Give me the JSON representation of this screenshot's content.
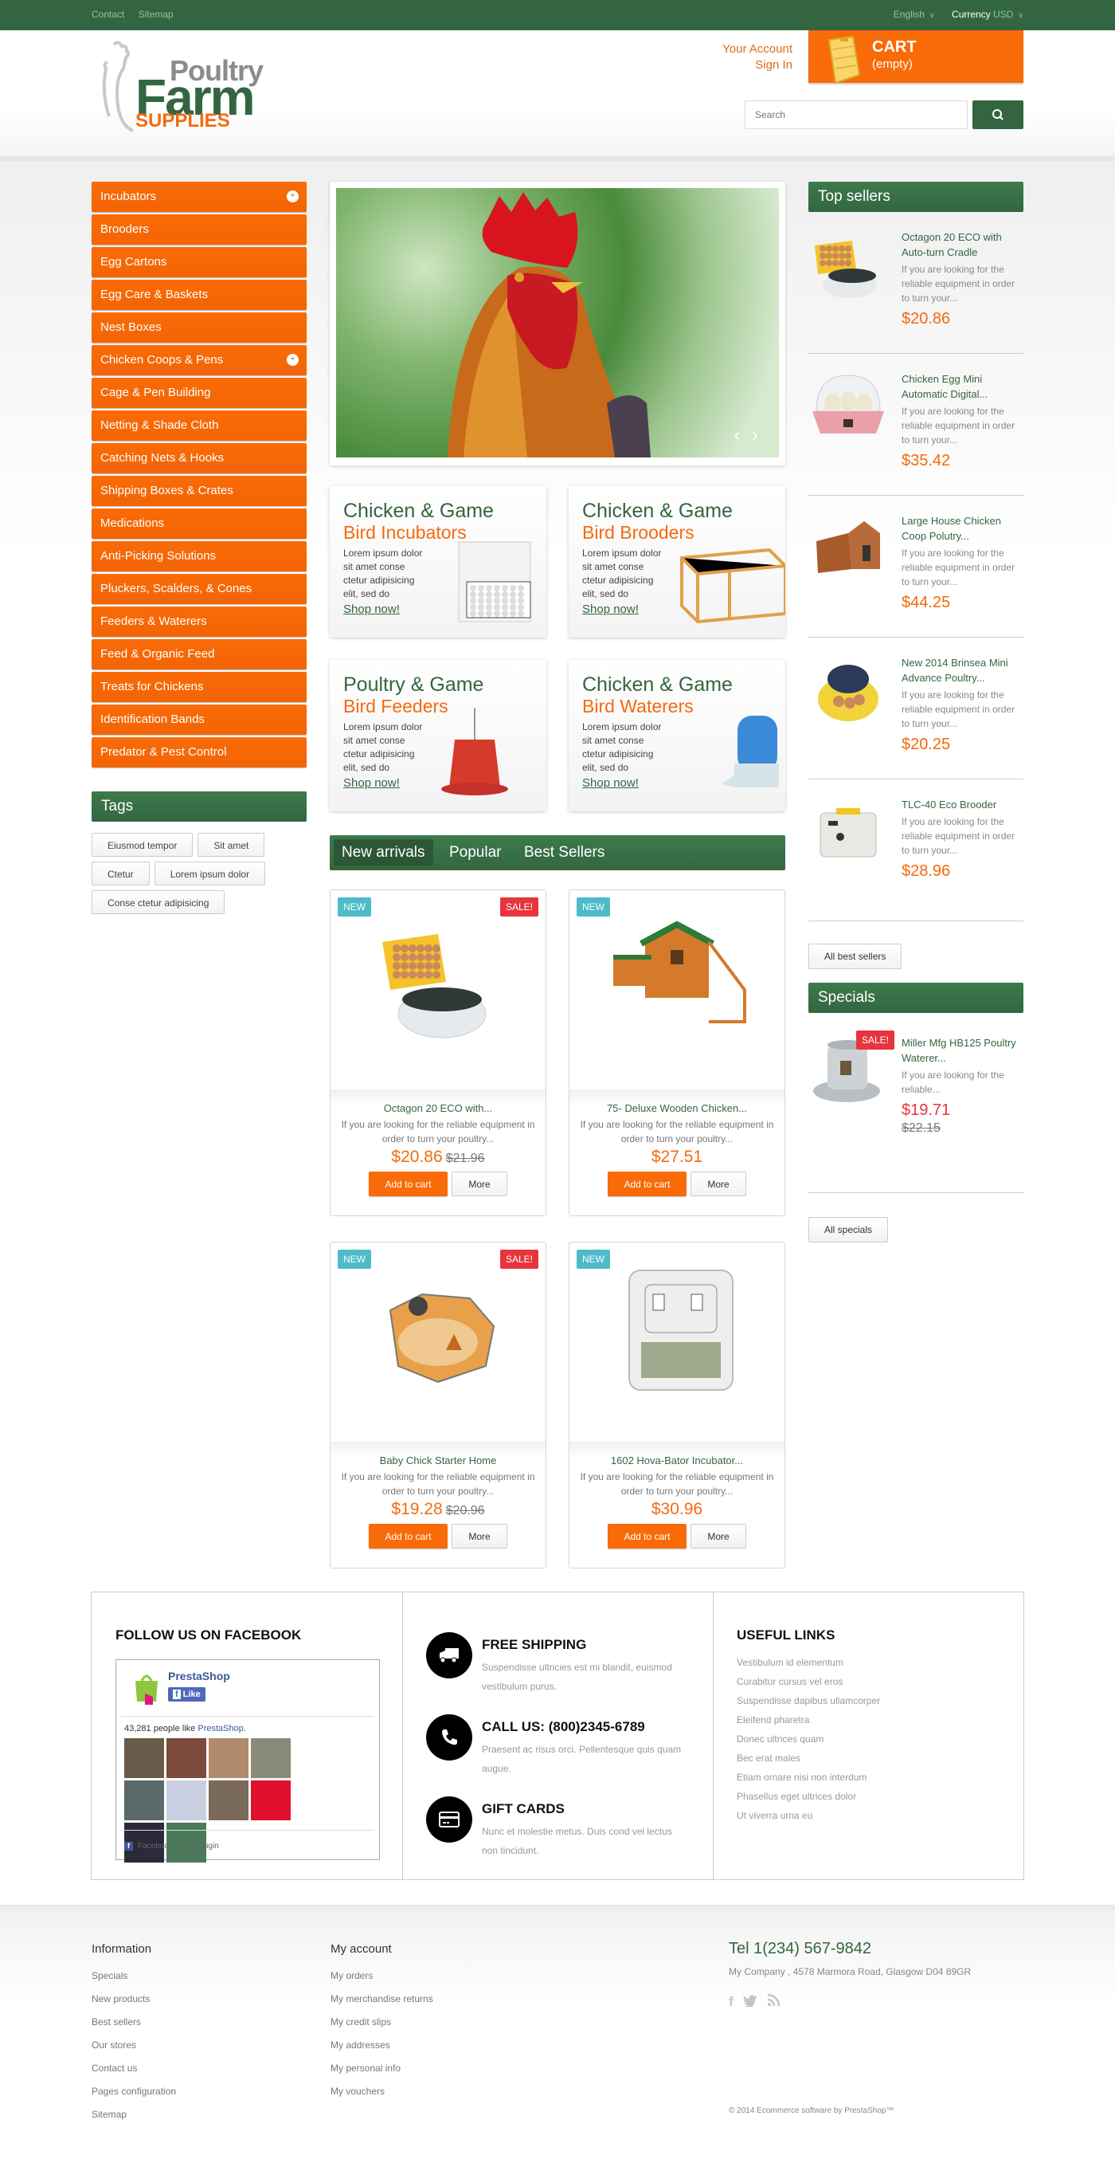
{
  "topbar": {
    "links": [
      "Contact",
      "Sitemap"
    ],
    "language": "English",
    "currency_label": "Currency",
    "currency_value": "USD"
  },
  "header": {
    "logo": {
      "line1": "Poultry",
      "line2": "Farm",
      "line3": "SUPPLIES"
    },
    "account": {
      "your_account": "Your Account",
      "sign_in": "Sign In"
    },
    "cart": {
      "title": "CART",
      "status": "(empty)"
    },
    "search": {
      "placeholder": "Search"
    }
  },
  "colors": {
    "brand_green": "#336640",
    "brand_orange": "#f96b08",
    "new_badge": "#4ebbc9",
    "sale_badge": "#e8353d"
  },
  "categories": [
    {
      "label": "Incubators",
      "has_submenu": true
    },
    {
      "label": "Brooders",
      "has_submenu": false
    },
    {
      "label": "Egg Cartons",
      "has_submenu": false
    },
    {
      "label": "Egg Care & Baskets",
      "has_submenu": false
    },
    {
      "label": "Nest Boxes",
      "has_submenu": false
    },
    {
      "label": "Chicken Coops & Pens",
      "has_submenu": true
    },
    {
      "label": "Cage & Pen Building",
      "has_submenu": false
    },
    {
      "label": "Netting & Shade Cloth",
      "has_submenu": false
    },
    {
      "label": "Catching Nets & Hooks",
      "has_submenu": false
    },
    {
      "label": "Shipping Boxes & Crates",
      "has_submenu": false
    },
    {
      "label": "Medications",
      "has_submenu": false
    },
    {
      "label": "Anti-Picking Solutions",
      "has_submenu": false
    },
    {
      "label": "Pluckers, Scalders, & Cones",
      "has_submenu": false
    },
    {
      "label": "Feeders & Waterers",
      "has_submenu": false
    },
    {
      "label": "Feed & Organic Feed",
      "has_submenu": false
    },
    {
      "label": "Treats for Chickens",
      "has_submenu": false
    },
    {
      "label": "Identification Bands",
      "has_submenu": false
    },
    {
      "label": "Predator & Pest Control",
      "has_submenu": false
    }
  ],
  "tags": {
    "title": "Tags",
    "items": [
      "Eiusmod tempor",
      "Sit amet",
      "Ctetur",
      "Lorem ipsum dolor",
      "Conse ctetur adipisicing"
    ]
  },
  "slider": {
    "prev": "‹",
    "next": "›"
  },
  "banners": [
    {
      "line1": "Chicken & Game",
      "line2": "Bird Incubators",
      "text": "Lorem ipsum dolor sit amet conse ctetur adipisicing elit, sed do",
      "link": "Shop now!"
    },
    {
      "line1": "Chicken & Game",
      "line2": "Bird Brooders",
      "text": "Lorem ipsum dolor sit amet conse ctetur adipisicing elit, sed do",
      "link": "Shop now!"
    },
    {
      "line1": "Poultry & Game",
      "line2": "Bird Feeders",
      "text": "Lorem ipsum dolor sit amet conse ctetur adipisicing elit, sed do",
      "link": "Shop now!"
    },
    {
      "line1": "Chicken & Game",
      "line2": "Bird Waterers",
      "text": "Lorem ipsum dolor sit amet conse ctetur adipisicing elit, sed do",
      "link": "Shop now!"
    }
  ],
  "product_tabs": [
    "New arrivals",
    "Popular",
    "Best Sellers"
  ],
  "products": [
    {
      "name": "Octagon 20 ECO with...",
      "desc": "If you are looking for the reliable equipment in order to turn your poultry...",
      "price": "$20.86",
      "old_price": "$21.96",
      "new": "NEW",
      "sale": "SALE!",
      "add": "Add to cart",
      "more": "More"
    },
    {
      "name": "75- Deluxe Wooden Chicken...",
      "desc": "If you are looking for the reliable equipment in order to turn your poultry...",
      "price": "$27.51",
      "old_price": "",
      "new": "NEW",
      "sale": "",
      "add": "Add to cart",
      "more": "More"
    },
    {
      "name": "Baby Chick Starter Home",
      "desc": "If you are looking for the reliable equipment in order to turn your poultry...",
      "price": "$19.28",
      "old_price": "$20.96",
      "new": "NEW",
      "sale": "SALE!",
      "add": "Add to cart",
      "more": "More"
    },
    {
      "name": "1602 Hova-Bator Incubator...",
      "desc": "If you are looking for the reliable equipment in order to turn your poultry...",
      "price": "$30.96",
      "old_price": "",
      "new": "NEW",
      "sale": "",
      "add": "Add to cart",
      "more": "More"
    }
  ],
  "top_sellers": {
    "title": "Top sellers",
    "items": [
      {
        "name": "Octagon 20 ECO with Auto-turn Cradle",
        "desc": "If you are looking for the reliable equipment in order to turn your...",
        "price": "$20.86"
      },
      {
        "name": "Chicken Egg Mini Automatic Digital...",
        "desc": "If you are looking for the reliable equipment in order to turn your...",
        "price": "$35.42"
      },
      {
        "name": "Large House Chicken Coop Polutry...",
        "desc": "If you are looking for the reliable equipment in order to turn your...",
        "price": "$44.25"
      },
      {
        "name": "New 2014 Brinsea Mini Advance Poultry...",
        "desc": "If you are looking for the reliable equipment in order to turn your...",
        "price": "$20.25"
      },
      {
        "name": "TLC-40 Eco Brooder",
        "desc": "If you are looking for the reliable equipment in order to turn your...",
        "price": "$28.96"
      }
    ],
    "all_button": "All best sellers"
  },
  "specials": {
    "title": "Specials",
    "item": {
      "name": "Miller Mfg HB125 Poultry Waterer...",
      "desc": "If you are looking for the reliable...",
      "price": "$19.71",
      "old_price": "$22.15",
      "sale": "SALE!"
    },
    "all_button": "All specials"
  },
  "facebook": {
    "title": "FOLLOW US ON FACEBOOK",
    "page_name": "PrestaShop",
    "like": "Like",
    "count_text": "43,281 people like",
    "count_link": "PrestaShop.",
    "plugin": "Facebook social plugin"
  },
  "services": [
    {
      "icon": "truck-icon",
      "title": "FREE SHIPPING",
      "text": "Suspendisse ultricies est mi blandit, euismod vestibulum purus."
    },
    {
      "icon": "phone-icon",
      "title": "CALL US: (800)2345-6789",
      "text": "Praesent ac risus orci. Pellentesque quis quam augue."
    },
    {
      "icon": "credit-card-icon",
      "title": "GIFT CARDS",
      "text": "Nunc et molestie metus. Duis cond vel lectus non tincidunt."
    }
  ],
  "useful_links": {
    "title": "USEFUL LINKS",
    "items": [
      "Vestibulum id elementum",
      "Curabitur cursus vel eros",
      "Suspendisse dapibus ullamcorper",
      "Eleifend pharetra",
      "Donec ultrices quam",
      "Bec erat males",
      "Etiam ornare nisi non interdum",
      "Phasellus eget ultrices dolor",
      "Ut viverra urna eu"
    ]
  },
  "footer": {
    "information": {
      "title": "Information",
      "items": [
        "Specials",
        "New products",
        "Best sellers",
        "Our stores",
        "Contact us",
        "Pages configuration",
        "Sitemap"
      ]
    },
    "account": {
      "title": "My account",
      "items": [
        "My orders",
        "My merchandise returns",
        "My credit slips",
        "My addresses",
        "My personal info",
        "My vouchers"
      ]
    },
    "tel": "Tel 1(234) 567-9842",
    "address": "My Company , 4578 Marmora Road, Glasgow D04 89GR",
    "copyright": "© 2014 Ecommerce software by PrestaShop™"
  }
}
